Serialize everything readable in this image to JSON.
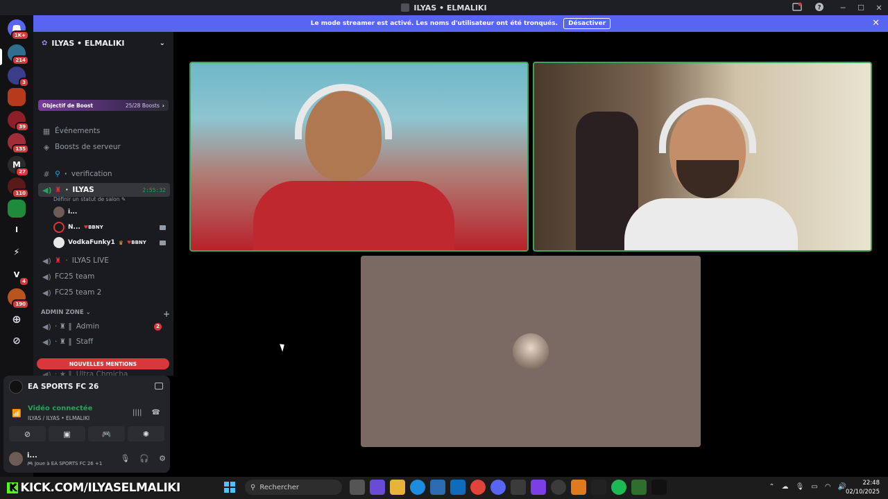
{
  "window": {
    "title": "ILYAS • ELMALIKI"
  },
  "banner": {
    "text": "Le mode streamer est activé. Les noms d'utilisateur ont été tronqués.",
    "button": "Désactiver"
  },
  "guilds": [
    {
      "label": "1K+",
      "color": "#5865f2"
    },
    {
      "badge": "214",
      "color": "#2f6e8f"
    },
    {
      "badge": "3",
      "color": "#3a3d8a"
    },
    {
      "label": "",
      "color": "#b83a1d"
    },
    {
      "badge": "39",
      "color": "#8c1f28"
    },
    {
      "badge": "135",
      "color": "#a12d3b"
    },
    {
      "badge": "27",
      "color": "#2a2a2a"
    },
    {
      "badge": "110",
      "color": "#5a1a1a"
    },
    {
      "label": "",
      "color": "#1e8a3c"
    },
    {
      "label": "I",
      "color": "#121214"
    },
    {
      "label": "",
      "color": "#121214"
    },
    {
      "label": "V",
      "badge": "4",
      "color": "#121214"
    },
    {
      "badge": "190",
      "color": "#b8541e"
    }
  ],
  "server": {
    "name": "ILYAS • ELMALIKI"
  },
  "boost": {
    "label": "Objectif de Boost",
    "progress": "25/28 Boosts"
  },
  "channels": {
    "events": "Événements",
    "boosts": "Boosts de serveur",
    "verification": "verification",
    "ilyas": "ILYAS",
    "ilyas_timer": "2:55:32",
    "status_prompt": "Définir un statut de salon",
    "ilyas_live": "ILYAS LIVE",
    "fc25_team": "FC25 team",
    "fc25_team2": "FC25 team 2",
    "admin_zone": "ADMIN ZONE",
    "admin": "Admin",
    "admin_badge": "2",
    "staff": "Staff",
    "ultra": "Ultra Chmicha"
  },
  "voice_users": [
    {
      "name": "i...",
      "tag": ""
    },
    {
      "name": "N...",
      "tag": "BBNY"
    },
    {
      "name": "VodkaFunky1",
      "tag": "BBNY"
    }
  ],
  "mentions": "NOUVELLES MENTIONS",
  "activity": {
    "game": "EA SPORTS FC 26"
  },
  "voice": {
    "status": "Vidéo connectée",
    "location": "ILYAS / ILYAS • ELMALIKI"
  },
  "user": {
    "name": "i...",
    "status": "Joue à EA SPORTS FC 26",
    "extra": "+1"
  },
  "taskbar": {
    "kick": "KICK.COM/ILYASELMALIKI",
    "search": "Rechercher",
    "time": "22:48",
    "date": "02/10/2025"
  }
}
